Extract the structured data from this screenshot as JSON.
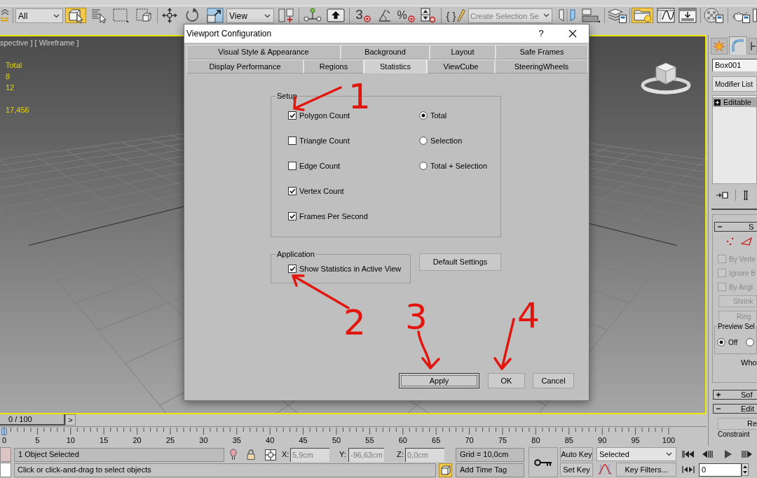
{
  "toolbar": [
    {
      "kind": "button",
      "selected": false
    },
    {
      "kind": "dropdown",
      "value": "All"
    },
    {
      "kind": "button",
      "selected": true
    },
    {
      "kind": "button",
      "selected": false
    },
    {
      "kind": "button",
      "selected": false
    },
    {
      "kind": "button",
      "selected": false
    },
    {
      "kind": "button",
      "selected": false
    },
    {
      "kind": "button",
      "selected": false
    },
    {
      "kind": "button",
      "selected": false
    },
    {
      "kind": "dropdown",
      "value": "View"
    },
    {
      "kind": "button",
      "selected": false
    },
    {
      "kind": "button",
      "selected": false
    },
    {
      "kind": "button",
      "selected": false
    },
    {
      "kind": "glyph",
      "label": "3",
      "selected": false
    },
    {
      "kind": "button",
      "selected": false
    },
    {
      "kind": "glyph",
      "label": "%",
      "selected": false
    },
    {
      "kind": "button",
      "selected": false
    },
    {
      "kind": "glyph",
      "label": "{ }",
      "selected": false
    },
    {
      "kind": "combo",
      "placeholder": "Create Selection Se"
    },
    {
      "kind": "button",
      "selected": false
    },
    {
      "kind": "button",
      "selected": false
    },
    {
      "kind": "button",
      "selected": false
    },
    {
      "kind": "button",
      "selected": true
    },
    {
      "kind": "button",
      "selected": false
    },
    {
      "kind": "button",
      "selected": false
    },
    {
      "kind": "button",
      "selected": false
    },
    {
      "kind": "button",
      "selected": false
    },
    {
      "kind": "button",
      "selected": false
    }
  ],
  "viewport": {
    "label": "spective ] [ Wireframe ]",
    "stats": {
      "header": "Total",
      "values": [
        "8",
        "12"
      ],
      "fps": "17,456"
    }
  },
  "dialog": {
    "title": "Viewport Configuration",
    "help": "?",
    "tab_rows": [
      [
        {
          "label": "Visual Style & Appearance",
          "selected": false
        },
        {
          "label": "Background",
          "selected": false
        },
        {
          "label": "Layout",
          "selected": false
        },
        {
          "label": "Safe Frames",
          "selected": false
        }
      ],
      [
        {
          "label": "Display Performance",
          "selected": false
        },
        {
          "label": "Regions",
          "selected": false
        },
        {
          "label": "Statistics",
          "selected": true
        },
        {
          "label": "ViewCube",
          "selected": false
        },
        {
          "label": "SteeringWheels",
          "selected": false
        }
      ]
    ],
    "setup": {
      "title": "Setup",
      "checkboxes": [
        {
          "label": "Polygon Count",
          "checked": true
        },
        {
          "label": "Triangle Count",
          "checked": false
        },
        {
          "label": "Edge Count",
          "checked": false
        },
        {
          "label": "Vertex Count",
          "checked": true
        },
        {
          "label": "Frames Per Second",
          "checked": true
        }
      ],
      "radios": [
        {
          "label": "Total",
          "selected": true
        },
        {
          "label": "Selection",
          "selected": false
        },
        {
          "label": "Total + Selection",
          "selected": false
        }
      ]
    },
    "application": {
      "title": "Application",
      "checkbox": {
        "label": "Show Statistics in Active View",
        "checked": true
      }
    },
    "default_button": "Default Settings",
    "buttons": [
      {
        "label": "Apply",
        "focused": true
      },
      {
        "label": "OK",
        "focused": false
      },
      {
        "label": "Cancel",
        "focused": false
      }
    ]
  },
  "annotations": [
    {
      "label": "1"
    },
    {
      "label": "2"
    },
    {
      "label": "3"
    },
    {
      "label": "4"
    }
  ],
  "command_panel": {
    "tabs": [
      {
        "selected": false
      },
      {
        "selected": true
      },
      {
        "selected": false
      }
    ],
    "object_name": "Box001",
    "modifier_list": "Modifier List",
    "stack": [
      {
        "label": "Editable",
        "selected": true
      }
    ],
    "rollouts": [
      {
        "title": "S",
        "expanded": true
      },
      {
        "title": "Sof",
        "expanded": false
      },
      {
        "title": "Edit",
        "expanded": true
      }
    ],
    "options": [
      {
        "label": "By Verte",
        "checked": false,
        "disabled": true
      },
      {
        "label": "Ignore B",
        "checked": false,
        "disabled": true
      },
      {
        "label": "By Angl",
        "checked": false,
        "disabled": true
      }
    ],
    "buttons": [
      {
        "label": "Shrink",
        "disabled": true
      },
      {
        "label": "Ring",
        "disabled": true
      }
    ],
    "preview": {
      "title": "Preview Sel",
      "radios": [
        {
          "label": "Off",
          "selected": true
        },
        {
          "selected": false
        }
      ]
    },
    "note": "Who",
    "bottom_button": "Re",
    "group": "Constraint"
  },
  "timeline": {
    "slider": {
      "label": "0 / 100",
      "level": 0
    },
    "next": ">",
    "ruler": [
      "0",
      "5",
      "10",
      "15",
      "20",
      "25",
      "30",
      "35",
      "40",
      "45",
      "50",
      "55",
      "60",
      "65",
      "70",
      "75",
      "80",
      "85",
      "90",
      "95",
      "100"
    ]
  },
  "status": {
    "selection": "1 Object Selected",
    "prompt": "Click or click-and-drag to select objects",
    "coords": [
      {
        "axis": "X:",
        "value": "5,9cm",
        "disabled": true
      },
      {
        "axis": "Y:",
        "value": "-96,63cm",
        "disabled": true
      },
      {
        "axis": "Z:",
        "value": "0,0cm",
        "disabled": true
      }
    ],
    "grid": "Grid = 10,0cm",
    "toggle": {
      "on": true
    },
    "time_tag": "Add Time Tag",
    "auto_key": "Auto Key",
    "set_key": "Set Key",
    "key_mode": "Selected",
    "key_filters": "Key Filters...",
    "frame": "0"
  }
}
